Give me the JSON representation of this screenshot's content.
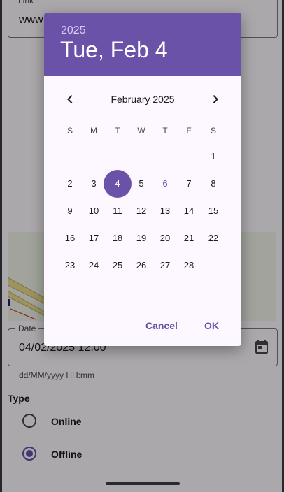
{
  "form": {
    "link_label": "Link",
    "link_value": "www",
    "date_label": "Date",
    "date_value": "04/02/2025 12:00",
    "date_format_hint": "dd/MM/yyyy HH:mm",
    "type_title": "Type",
    "type_options": [
      {
        "label": "Online",
        "selected": false
      },
      {
        "label": "Offline",
        "selected": true
      }
    ]
  },
  "date_picker": {
    "header_year": "2025",
    "header_date": "Tue, Feb 4",
    "month_title": "February 2025",
    "weekdays": [
      "S",
      "M",
      "T",
      "W",
      "T",
      "F",
      "S"
    ],
    "first_weekday_index": 6,
    "days_in_month": 28,
    "selected_day": 4,
    "today_day": 6,
    "cancel_label": "Cancel",
    "ok_label": "OK",
    "icons": {
      "prev": "chevron-left-icon",
      "next": "chevron-right-icon",
      "calendar": "calendar-icon"
    }
  },
  "colors": {
    "accent": "#6750a4",
    "header": "#6a52a8",
    "dialog_background": "#fdf7ff"
  }
}
